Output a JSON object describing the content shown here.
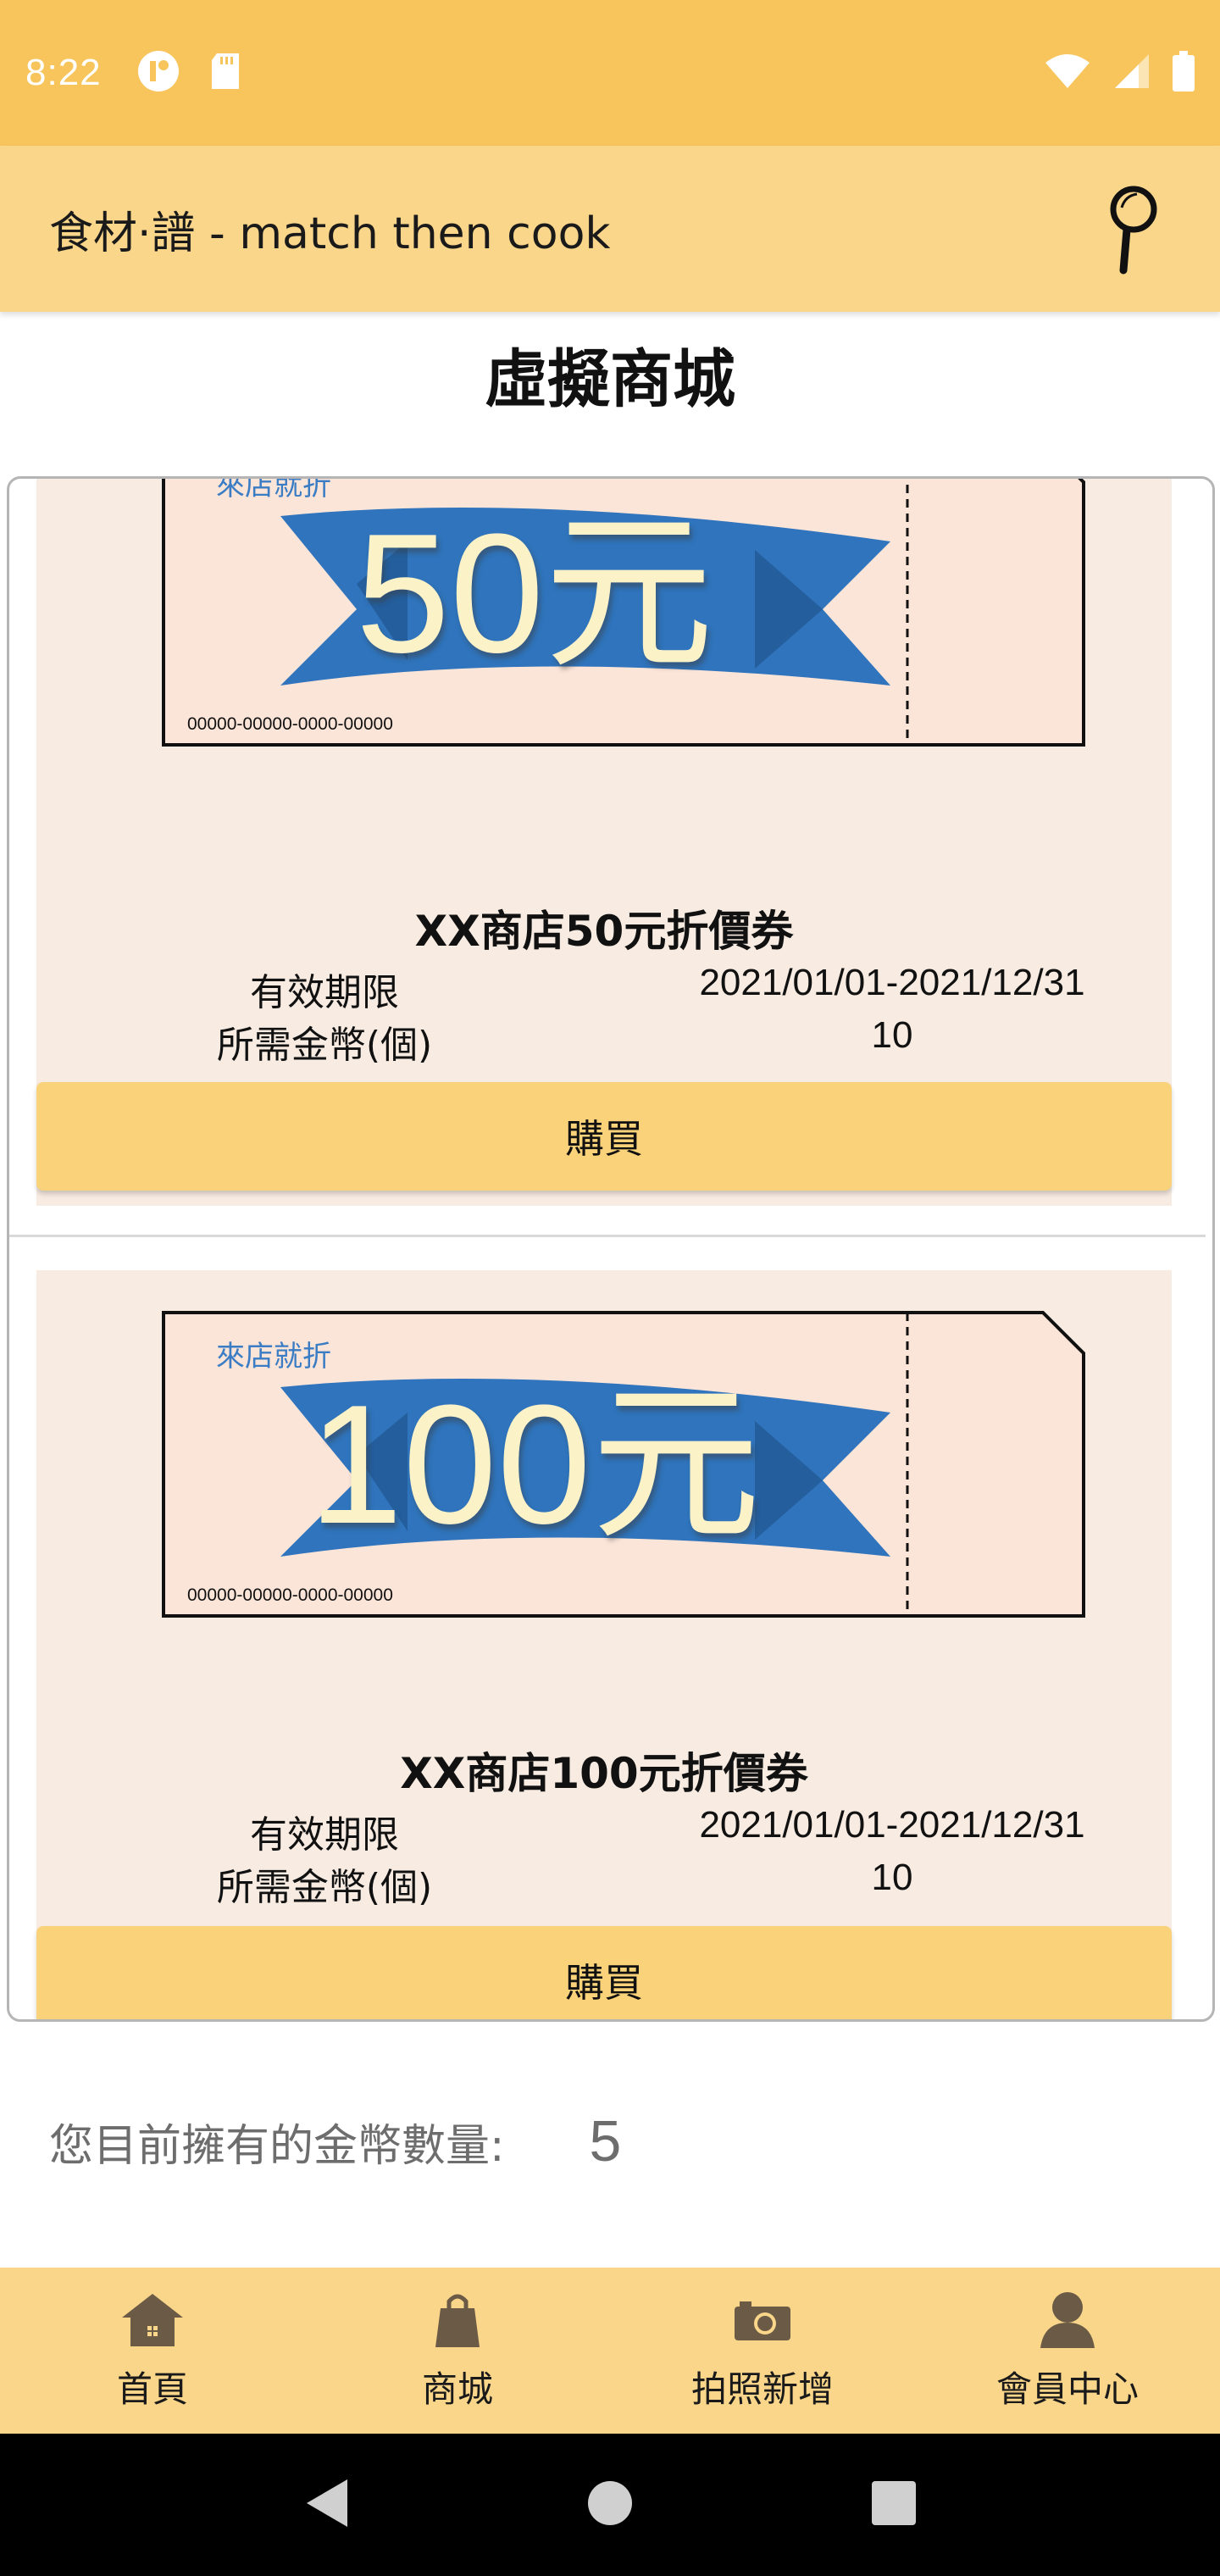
{
  "status_bar": {
    "time": "8:22"
  },
  "app_bar": {
    "title": "食材·譜 - match then cook"
  },
  "page_title": "虛擬商城",
  "coupons": [
    {
      "coupon_label": "來店就折",
      "coupon_amount": "50元",
      "coupon_serial": "00000-00000-0000-00000",
      "name": "XX商店50元折價券",
      "validity_label": "有效期限",
      "validity_value": "2021/01/01-2021/12/31",
      "coins_label": "所需金幣(個)",
      "coins_value": "10",
      "buy_label": "購買"
    },
    {
      "coupon_label": "來店就折",
      "coupon_amount": "100元",
      "coupon_serial": "00000-00000-0000-00000",
      "name": "XX商店100元折價券",
      "validity_label": "有效期限",
      "validity_value": "2021/01/01-2021/12/31",
      "coins_label": "所需金幣(個)",
      "coins_value": "10",
      "buy_label": "購買"
    }
  ],
  "wallet": {
    "label": "您目前擁有的金幣數量:",
    "value": "5"
  },
  "bottom_nav": {
    "items": [
      {
        "label": "首頁",
        "icon": "home-icon"
      },
      {
        "label": "商城",
        "icon": "shopping-bag-icon"
      },
      {
        "label": "拍照新增",
        "icon": "camera-icon"
      },
      {
        "label": "會員中心",
        "icon": "person-icon"
      }
    ]
  },
  "colors": {
    "status_bar": "#F7C55B",
    "app_bar": "#F9D68A",
    "card_bg": "#F7EBE2",
    "buy_button": "#F9D27A",
    "ribbon": "#2F74BC"
  }
}
